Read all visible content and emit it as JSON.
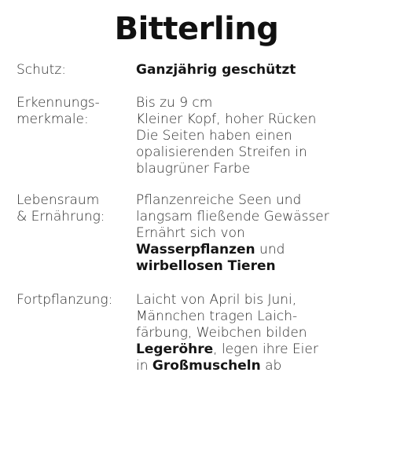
{
  "title": "Bitterling",
  "schutz": {
    "label": "Schutz:",
    "value": "Ganzjährig geschützt"
  },
  "merkmale": {
    "label_lines": [
      "Erkennungs-",
      "merkmale:"
    ],
    "lines": [
      "Bis zu 9 cm",
      "Kleiner Kopf, hoher Rücken",
      "Die Seiten haben einen",
      "opalisierenden Streifen in",
      "blaugrüner Farbe"
    ]
  },
  "lebensraum": {
    "label_lines": [
      "Lebensraum",
      "& Ernährung:"
    ],
    "lines": [
      "Pflanzenreiche Seen und",
      "langsam fließende Gewässer",
      "Ernährt sich von"
    ],
    "line4_bold": "Wasserpflanzen",
    "line4_rest": " und",
    "line5_bold": "wirbellosen Tieren"
  },
  "fortpflanzung": {
    "label": "Fortpflanzung:",
    "lines": [
      "Laicht von April bis Juni,",
      "Männchen tragen Laich-",
      "färbung, Weibchen bilden"
    ],
    "line4_bold": "Legeröhre",
    "line4_rest": ", legen ihre Eier",
    "line5_pre": "in ",
    "line5_bold": "Großmuscheln",
    "line5_rest": " ab"
  }
}
